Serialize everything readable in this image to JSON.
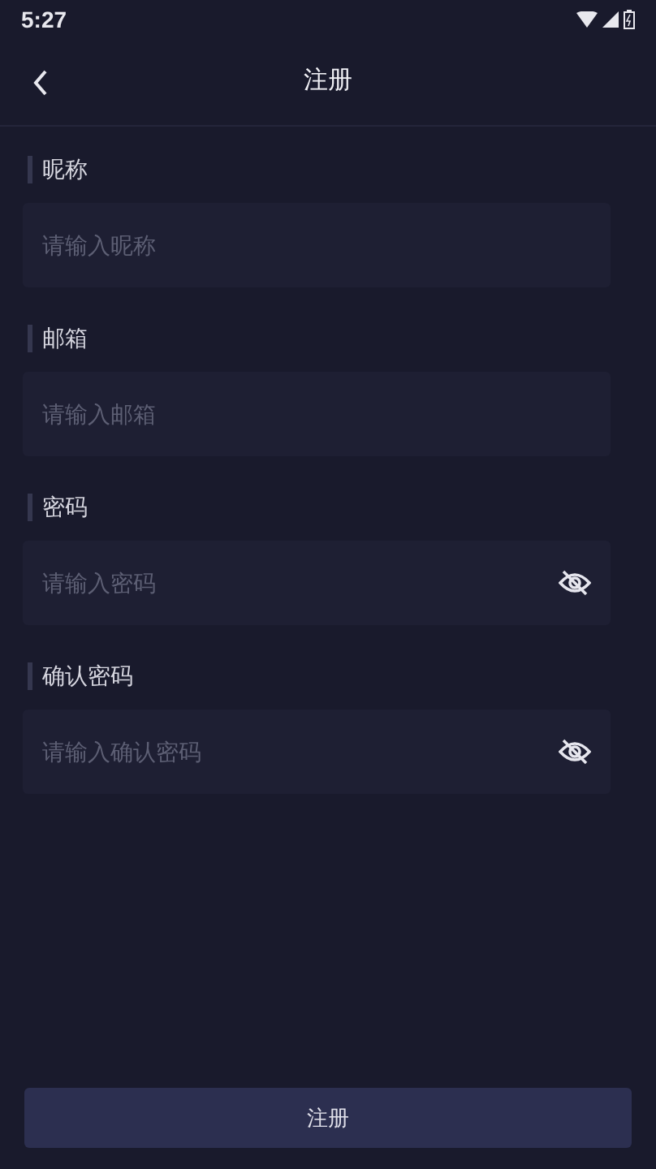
{
  "status_bar": {
    "time": "5:27"
  },
  "header": {
    "title": "注册"
  },
  "fields": [
    {
      "label": "昵称",
      "placeholder": "请输入昵称",
      "kind": "text"
    },
    {
      "label": "邮箱",
      "placeholder": "请输入邮箱",
      "kind": "text"
    },
    {
      "label": "密码",
      "placeholder": "请输入密码",
      "kind": "password",
      "visible": false
    },
    {
      "label": "确认密码",
      "placeholder": "请输入确认密码",
      "kind": "password",
      "visible": false
    }
  ],
  "submit_button": "注册"
}
